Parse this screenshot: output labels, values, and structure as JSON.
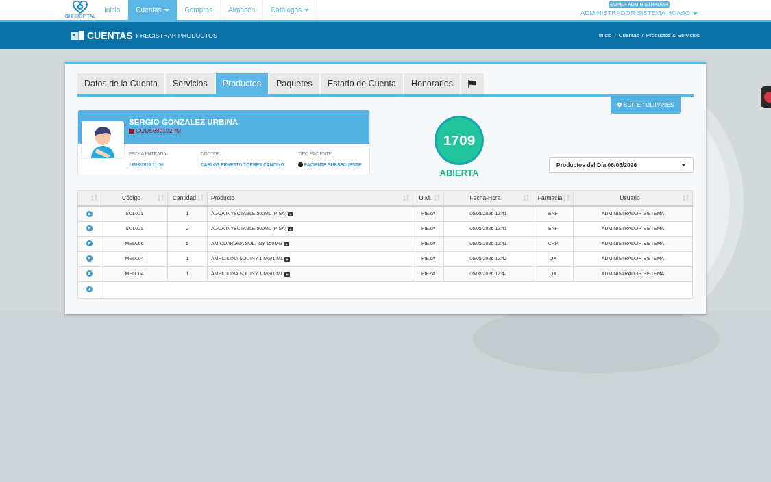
{
  "logo": {
    "text": "**BH**HOSPITAL"
  },
  "nav": [
    {
      "label": "Inicio",
      "selected": false,
      "dropdown": false
    },
    {
      "label": "Cuentas",
      "selected": true,
      "dropdown": true
    },
    {
      "label": "Compras",
      "selected": false,
      "dropdown": false
    },
    {
      "label": "Almacén",
      "selected": false,
      "dropdown": false
    },
    {
      "label": "Catálogos",
      "selected": false,
      "dropdown": true
    }
  ],
  "user": {
    "role": "SUPER ADMINISTRADOR",
    "name": "ADMINISTRADOR SISTEMA HCASO"
  },
  "header": {
    "title": "CUENTAS",
    "separator": "›",
    "subtitle": "REGISTRAR PRODUCTOS"
  },
  "breadcrumb": [
    {
      "label": "Inicio"
    },
    {
      "label": "Cuentas",
      "separator": "/"
    },
    {
      "label": "Productos & Servicios",
      "separator": "/"
    }
  ],
  "tabs": [
    {
      "label": "Datos de la Cuenta",
      "selected": false,
      "kind": "text"
    },
    {
      "label": "Servicios",
      "selected": false,
      "kind": "text"
    },
    {
      "label": "Productos",
      "selected": true,
      "kind": "text"
    },
    {
      "label": "Paquetes",
      "selected": false,
      "kind": "text"
    },
    {
      "label": "Estado de Cuenta",
      "selected": false,
      "kind": "text"
    },
    {
      "label": "Honorarios",
      "selected": false,
      "kind": "text"
    },
    {
      "selected": false,
      "kind": "flag"
    }
  ],
  "location_button": "SUITE TULIPANES",
  "patient": {
    "name": "SERGIO GONZALEZ URBINA",
    "record": "GOUS680102PM",
    "fields": [
      {
        "label": "FECHA ENTRADA:",
        "value": "13/03/2026 11:56",
        "dot": false
      },
      {
        "label": "DOCTOR:",
        "value": "CARLOS ERNESTO TORRES CANCINO",
        "dot": false
      },
      {
        "label": "TIPO PACIENTE:",
        "value": "PACIENTE SUBSECUENTE",
        "dot": true
      }
    ]
  },
  "account": {
    "number": "1709",
    "status": "ABIERTA"
  },
  "filter_select": {
    "value": "Productos del Día 06/05/2026"
  },
  "table": {
    "columns": [
      "",
      "Código",
      "Cantidad",
      "Producto",
      "U.M.",
      "Fecha-Hora",
      "Farmacia",
      "Usuario"
    ],
    "rows": [
      {
        "codigo": "SOL001",
        "cantidad": "1",
        "producto": "AGUA INYECTABLE 500ML (PISA)",
        "um": "PIEZA",
        "fecha": "06/05/2026 12:41",
        "farmacia": "ENF",
        "usuario": "ADMINISTRADOR SISTEMA"
      },
      {
        "codigo": "SOL001",
        "cantidad": "2",
        "producto": "AGUA INYECTABLE 500ML (PISA)",
        "um": "PIEZA",
        "fecha": "06/05/2026 12:41",
        "farmacia": "ENF",
        "usuario": "ADMINISTRADOR SISTEMA"
      },
      {
        "codigo": "MED066",
        "cantidad": "5",
        "producto": "AMIODARONA SOL. INY 150MG",
        "um": "PIEZA",
        "fecha": "06/05/2026 12:41",
        "farmacia": "CRP",
        "usuario": "ADMINISTRADOR SISTEMA"
      },
      {
        "codigo": "MED004",
        "cantidad": "1",
        "producto": "AMPICILINA SOL INY 1 MG/1 ML",
        "um": "PIEZA",
        "fecha": "06/05/2026 12:42",
        "farmacia": "QX",
        "usuario": "ADMINISTRADOR SISTEMA"
      },
      {
        "codigo": "MED004",
        "cantidad": "1",
        "producto": "AMPICILINA SOL INY 1 MG/1 ML",
        "um": "PIEZA",
        "fecha": "06/05/2026 12:42",
        "farmacia": "QX",
        "usuario": "ADMINISTRADOR SISTEMA"
      }
    ]
  }
}
